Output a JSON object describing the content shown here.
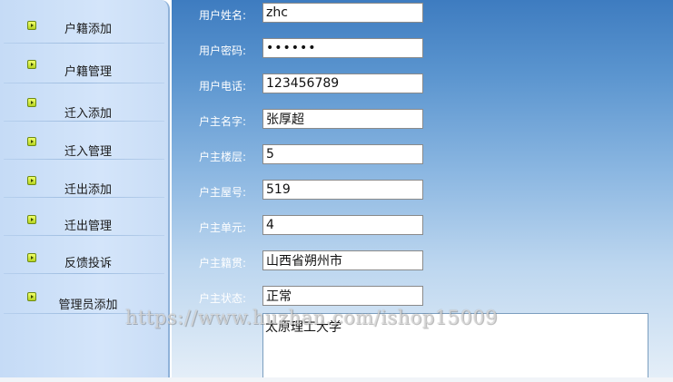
{
  "sidebar": {
    "items": [
      {
        "label": "户籍添加"
      },
      {
        "label": "户籍管理"
      },
      {
        "label": "迁入添加"
      },
      {
        "label": "迁入管理"
      },
      {
        "label": "迁出添加"
      },
      {
        "label": "迁出管理"
      },
      {
        "label": "反馈投诉"
      },
      {
        "label": "管理员添加"
      }
    ]
  },
  "form": {
    "username": {
      "label": "用户姓名:",
      "value": "zhc"
    },
    "password": {
      "label": "用户密码:",
      "value": "••••••"
    },
    "phone": {
      "label": "用户电话:",
      "value": "123456789"
    },
    "owner_name": {
      "label": "户主名字:",
      "value": "张厚超"
    },
    "floor": {
      "label": "户主楼层:",
      "value": "5"
    },
    "room": {
      "label": "户主屋号:",
      "value": "519"
    },
    "unit": {
      "label": "户主单元:",
      "value": "4"
    },
    "hometown": {
      "label": "户主籍贯:",
      "value": "山西省朔州市"
    },
    "status": {
      "label": "户主状态:",
      "value": "正常"
    },
    "remarks": {
      "value": "太原理工大学"
    }
  },
  "watermark": "https://www.huzhan.com/ishop15009",
  "colors": {
    "sidebar_bg": "#c9ddf6",
    "main_gradient_top": "#3e7cc0",
    "main_gradient_bottom": "#e4eef8",
    "label_text": "#ffffff",
    "bullet": "#c8e02a"
  }
}
